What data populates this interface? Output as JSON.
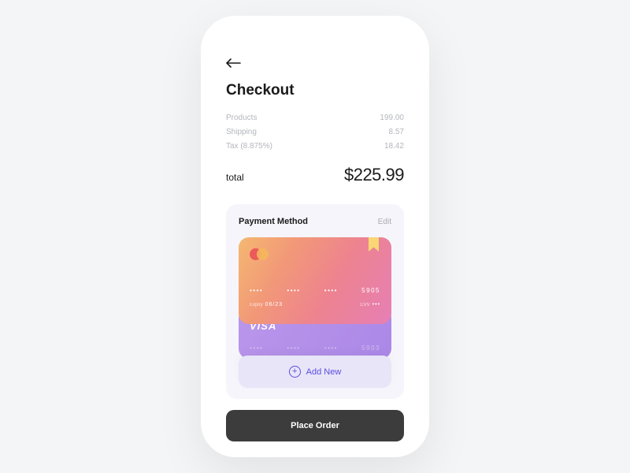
{
  "header": {
    "title": "Checkout"
  },
  "summary": {
    "items": [
      {
        "label": "Products",
        "value": "199.00"
      },
      {
        "label": "Shipping",
        "value": "8.57"
      },
      {
        "label": "Tax (8.875%)",
        "value": "18.42"
      }
    ],
    "total_label": "total",
    "total_value": "$225.99"
  },
  "payment": {
    "title": "Payment Method",
    "edit_label": "Edit",
    "cards": [
      {
        "brand": "mastercard",
        "groups": [
          "••••",
          "••••",
          "••••",
          "5905"
        ],
        "expiry_label": "Expiry",
        "expiry": "06/23",
        "cvv_label": "CVV",
        "cvv": "•••"
      },
      {
        "brand": "visa",
        "brand_text": "VISA",
        "groups": [
          "••••",
          "••••",
          "••••",
          "5903"
        ]
      }
    ],
    "add_new_label": "Add New"
  },
  "actions": {
    "place_order_label": "Place Order"
  }
}
